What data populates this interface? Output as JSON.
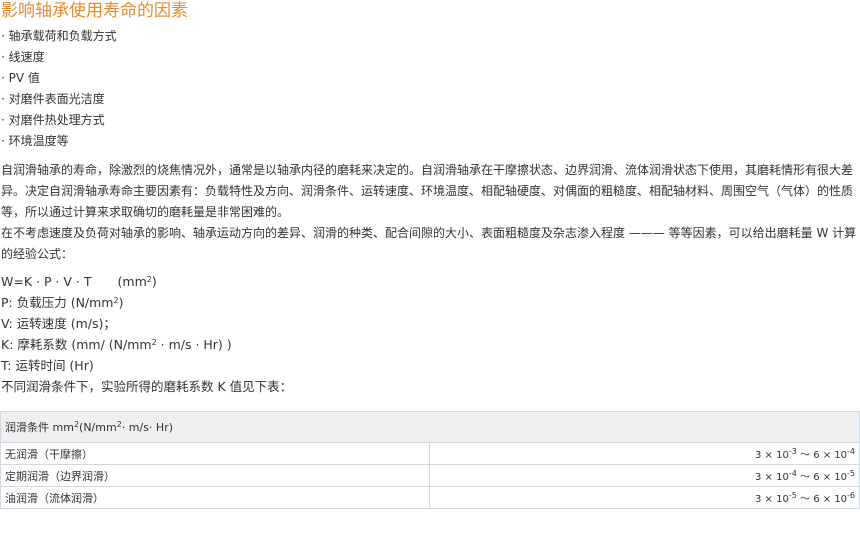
{
  "title": "影响轴承使用寿命的因素",
  "bullets": [
    "轴承载荷和负载方式",
    "线速度",
    "PV 值",
    "对磨件表面光洁度",
    "对磨件热处理方式",
    "环境温度等"
  ],
  "paragraphs": [
    "自润滑轴承的寿命，除激烈的烧焦情况外，通常是以轴承内径的磨耗来决定的。自润滑轴承在干摩擦状态、边界润滑、流体润滑状态下使用，其磨耗情形有很大差异。决定自润滑轴承寿命主要因素有：负载特性及方向、润滑条件、运转速度、环境温度、相配轴硬度、对偶面的粗糙度、相配轴材料、周围空气（气体）的性质等，所以通过计算来求取确切的磨耗量是非常困难的。",
    "在不考虑速度及负荷对轴承的影响、轴承运动方向的差异、润滑的种类、配合间隙的大小、表面粗糙度及杂志渗入程度 ——— 等等因素，可以给出磨耗量 W 计算的经验公式："
  ],
  "formula": {
    "main": "W=K · P · V · T",
    "main_unit_pre": "(mm",
    "main_unit_sup": "2",
    "main_unit_post": ")",
    "p_pre": "P: 负载压力 (N/mm",
    "p_sup": "2",
    "p_post": ")",
    "v_line": "V: 运转速度 (m/s)；",
    "k_pre": "K: 摩耗系数 (mm/ (N/mm",
    "k_sup": "2",
    "k_post": " · m/s · Hr) )",
    "t_line": "T: 运转时间 (Hr)",
    "note": "不同润滑条件下，实验所得的磨耗系数 K 值见下表："
  },
  "table": {
    "header_pre": "润滑条件 mm",
    "header_sup1": "2",
    "header_mid": "(N/mm",
    "header_sup2": "2",
    "header_post": "· m/s· Hr)",
    "rows": [
      {
        "condition": "无润滑（干摩擦）",
        "a": "3 × 10",
        "a_exp": "-3",
        "sep": " ～ ",
        "b": "6 × 10",
        "b_exp": "-4"
      },
      {
        "condition": "定期润滑（边界润滑）",
        "a": "3 × 10",
        "a_exp": "-4",
        "sep": " ～ ",
        "b": "6 × 10",
        "b_exp": "-5"
      },
      {
        "condition": "油润滑（流体润滑）",
        "a": "3 × 10",
        "a_exp": "-5",
        "sep": " ～ ",
        "b": "6 × 10",
        "b_exp": "-6"
      }
    ]
  },
  "colors": {
    "title": "#e98a2e",
    "text": "#333333",
    "table_border": "#cfd8e3",
    "table_header_bg": "#efefef"
  }
}
